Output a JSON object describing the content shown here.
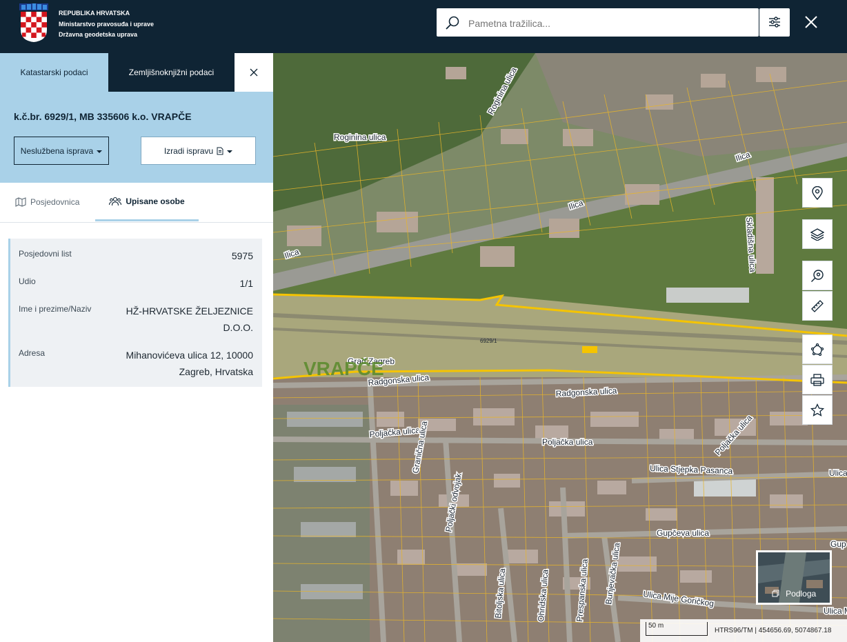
{
  "header": {
    "org_line1": "REPUBLIKA HRVATSKA",
    "org_line2": "Ministarstvo pravosuđa i uprave",
    "org_line3": "Državna geodetska uprava",
    "search_placeholder": "Pametna tražilica..."
  },
  "panel": {
    "tabs": [
      {
        "label": "Katastarski podaci"
      },
      {
        "label": "Zemljišnoknjižni podaci"
      }
    ],
    "parcel_title": "k.č.br. 6929/1, MB 335606 k.o. VRAPČE",
    "btn_unofficial": "Neslužbena isprava",
    "btn_create": "Izradi ispravu",
    "subtabs": [
      {
        "label": "Posjedovnica"
      },
      {
        "label": "Upisane osobe"
      }
    ],
    "fields": [
      {
        "label": "Posjedovni list",
        "value": "5975"
      },
      {
        "label": "Udio",
        "value": "1/1"
      },
      {
        "label": "Ime i prezime/Naziv",
        "value": "HŽ-HRVATSKE ŽELJEZNICE D.O.O."
      },
      {
        "label": "Adresa",
        "value": "Mihanovićeva ulica 12, 10000 Zagreb, Hrvatska"
      }
    ]
  },
  "map": {
    "streets": [
      "Roginina ulica",
      "Ilica",
      "Skladišna ulica",
      "Radgonska ulica",
      "Poljačka ulica",
      "Granična ulica",
      "Poljački odvojak",
      "Ulica Stjepka Pasanca",
      "Gupčeva ulica",
      "Bitoljska ulica",
      "Ohridska ulica",
      "Prespanska ulica",
      "Bunjevačka ulica",
      "Ulica Mije Goričkog",
      "Ulica M",
      "Ulica S",
      "Gup",
      "Poljačka ulica"
    ],
    "place_label": "Grad Zagreb",
    "district_label": "VRAPČE",
    "parcel_label": "6929/1",
    "basemap_label": "Podloga",
    "scale_label": "50 m",
    "coords": "HTRS96/TM | 454656.69, 5074867.18"
  },
  "colors": {
    "header_bg": "#0f2434",
    "tab_active_bg": "#a9d1e8",
    "parcel_outline": "#f5c400"
  }
}
